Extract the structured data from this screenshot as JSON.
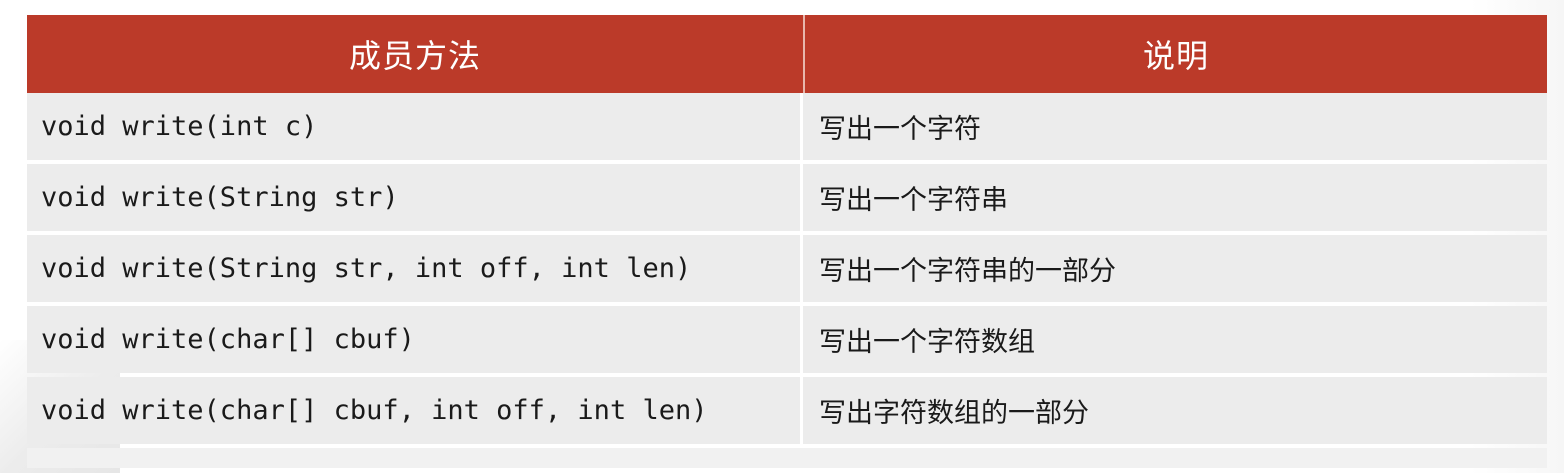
{
  "table": {
    "headers": [
      "成员方法",
      "说明"
    ],
    "rows": [
      {
        "method": "void write(int c)",
        "description": "写出一个字符"
      },
      {
        "method": "void write(String str)",
        "description": "写出一个字符串"
      },
      {
        "method": "void write(String str, int off, int len)",
        "description": "写出一个字符串的一部分"
      },
      {
        "method": "void write(char[] cbuf)",
        "description": "写出一个字符数组"
      },
      {
        "method": "void write(char[] cbuf, int off, int len)",
        "description": "写出字符数组的一部分"
      }
    ]
  },
  "colors": {
    "header_background": "#bb3a29",
    "header_text": "#ffffff",
    "row_background": "#ececec"
  }
}
